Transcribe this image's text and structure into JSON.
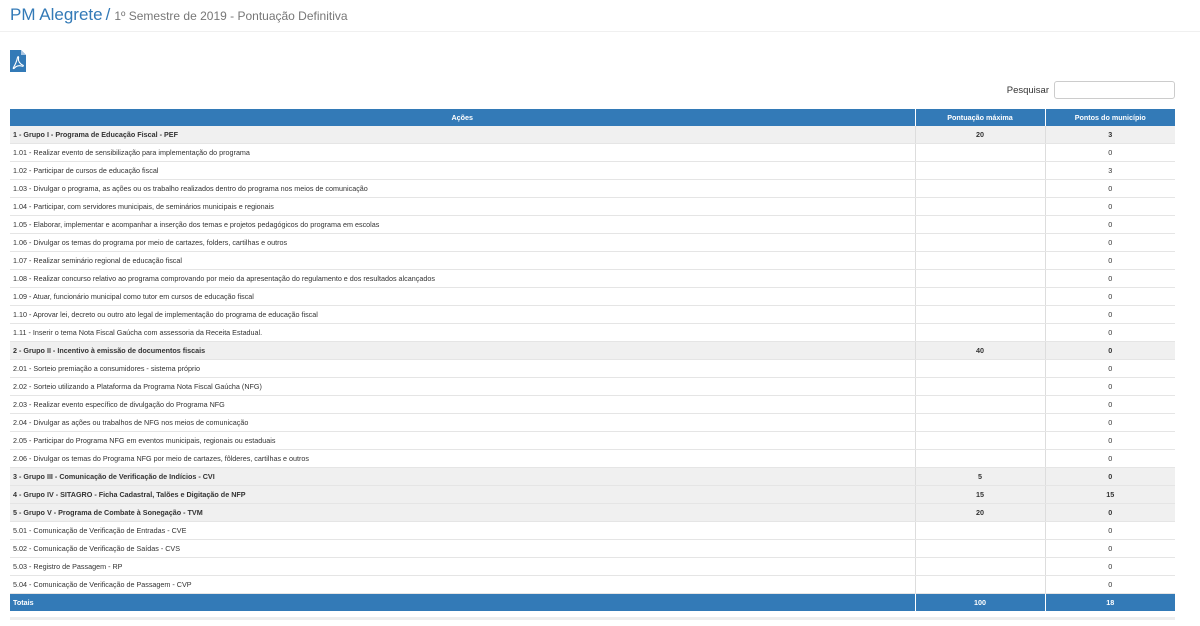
{
  "header": {
    "brand": "PM Alegrete",
    "separator": "/",
    "subtitle": "1º Semestre de 2019 - Pontuação Definitiva"
  },
  "toolbar": {
    "pdf_icon": "pdf-file-icon"
  },
  "search": {
    "label": "Pesquisar",
    "value": "",
    "placeholder": ""
  },
  "colors": {
    "accent": "#337ab7",
    "group_row_bg": "#f0f0f0"
  },
  "table": {
    "headers": [
      "Ações",
      "Pontuação máxima",
      "Pontos do município"
    ],
    "rows": [
      {
        "type": "group",
        "action": "1 - Grupo I - Programa de Educação Fiscal - PEF",
        "max": "20",
        "points": "3"
      },
      {
        "type": "item",
        "action": "1.01 - Realizar evento de sensibilização para implementação do programa",
        "max": "",
        "points": "0"
      },
      {
        "type": "item",
        "action": "1.02 - Participar de cursos de educação fiscal",
        "max": "",
        "points": "3"
      },
      {
        "type": "item",
        "action": "1.03 - Divulgar o programa, as ações ou os trabalho realizados dentro do programa nos meios de comunicação",
        "max": "",
        "points": "0"
      },
      {
        "type": "item",
        "action": "1.04 - Participar, com servidores municipais, de seminários municipais e regionais",
        "max": "",
        "points": "0"
      },
      {
        "type": "item",
        "action": "1.05 - Elaborar, implementar e acompanhar a inserção dos temas e projetos pedagógicos do programa em escolas",
        "max": "",
        "points": "0"
      },
      {
        "type": "item",
        "action": "1.06 - Divulgar os temas do programa por meio de cartazes, folders, cartilhas e outros",
        "max": "",
        "points": "0"
      },
      {
        "type": "item",
        "action": "1.07 - Realizar seminário regional de educação fiscal",
        "max": "",
        "points": "0"
      },
      {
        "type": "item",
        "action": "1.08 - Realizar concurso relativo ao programa comprovando por meio da apresentação do regulamento e dos resultados alcançados",
        "max": "",
        "points": "0"
      },
      {
        "type": "item",
        "action": "1.09 - Atuar, funcionário municipal como tutor em cursos de educação fiscal",
        "max": "",
        "points": "0"
      },
      {
        "type": "item",
        "action": "1.10 - Aprovar lei, decreto ou outro ato legal de implementação do programa de educação fiscal",
        "max": "",
        "points": "0"
      },
      {
        "type": "item",
        "action": "1.11 - Inserir o tema Nota Fiscal Gaúcha com assessoria da Receita Estadual.",
        "max": "",
        "points": "0"
      },
      {
        "type": "group",
        "action": "2 - Grupo II - Incentivo à emissão de documentos fiscais",
        "max": "40",
        "points": "0"
      },
      {
        "type": "item",
        "action": "2.01 - Sorteio premiação a consumidores - sistema próprio",
        "max": "",
        "points": "0"
      },
      {
        "type": "item",
        "action": "2.02 - Sorteio utilizando a Plataforma da Programa Nota Fiscal Gaúcha (NFG)",
        "max": "",
        "points": "0"
      },
      {
        "type": "item",
        "action": "2.03 - Realizar evento específico de divulgação do Programa NFG",
        "max": "",
        "points": "0"
      },
      {
        "type": "item",
        "action": "2.04 - Divulgar as ações ou trabalhos de NFG nos meios de comunicação",
        "max": "",
        "points": "0"
      },
      {
        "type": "item",
        "action": "2.05 - Participar do Programa NFG em eventos municipais, regionais ou estaduais",
        "max": "",
        "points": "0"
      },
      {
        "type": "item",
        "action": "2.06 - Divulgar os temas do Programa NFG por meio de cartazes, fôlderes, cartilhas e outros",
        "max": "",
        "points": "0"
      },
      {
        "type": "group",
        "action": "3 - Grupo III - Comunicação de Verificação de Indícios - CVI",
        "max": "5",
        "points": "0"
      },
      {
        "type": "group",
        "action": "4 - Grupo IV - SITAGRO - Ficha Cadastral, Talões e Digitação de NFP",
        "max": "15",
        "points": "15"
      },
      {
        "type": "group",
        "action": "5 - Grupo V - Programa de Combate à Sonegação - TVM",
        "max": "20",
        "points": "0"
      },
      {
        "type": "item",
        "action": "5.01 - Comunicação de Verificação de Entradas - CVE",
        "max": "",
        "points": "0"
      },
      {
        "type": "item",
        "action": "5.02 - Comunicação de Verificação de Saídas - CVS",
        "max": "",
        "points": "0"
      },
      {
        "type": "item",
        "action": "5.03 - Registro de Passagem - RP",
        "max": "",
        "points": "0"
      },
      {
        "type": "item",
        "action": "5.04 - Comunicação de Verificação de Passagem - CVP",
        "max": "",
        "points": "0"
      }
    ],
    "totals": {
      "label": "Totais",
      "max": "100",
      "points": "18"
    }
  }
}
